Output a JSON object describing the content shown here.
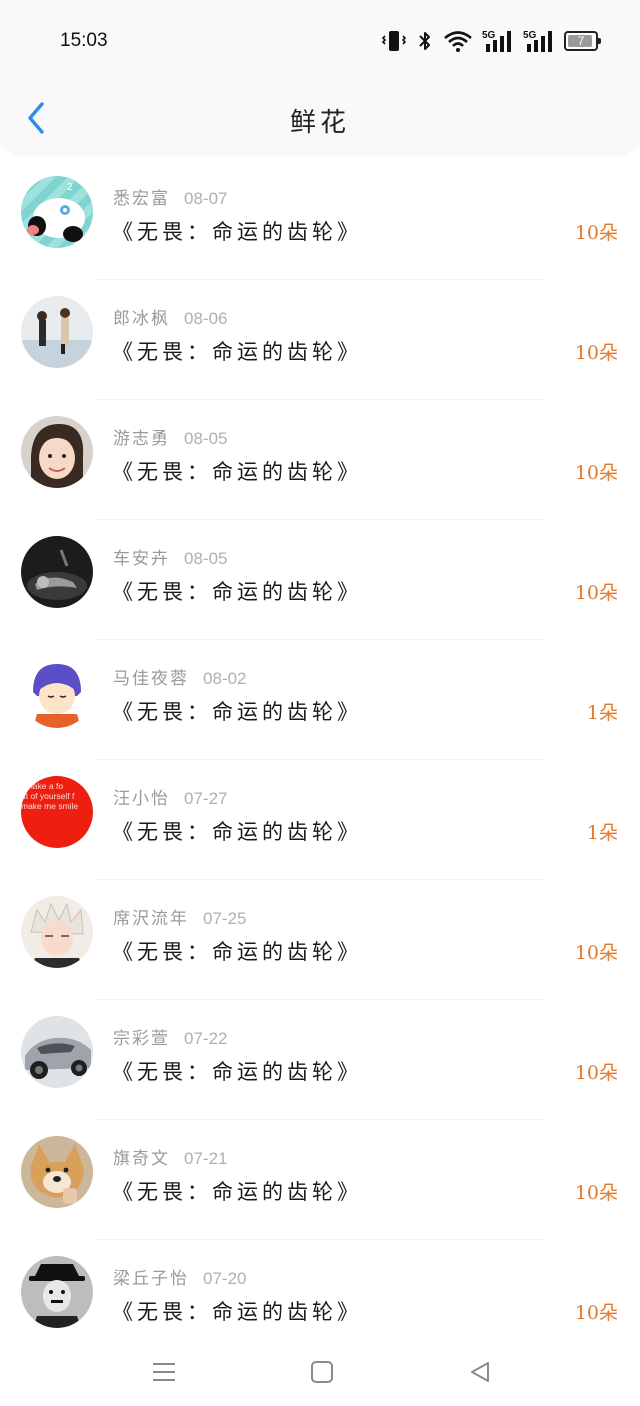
{
  "status": {
    "time": "15:03",
    "battery": "7",
    "icons": [
      "vibrate-icon",
      "bluetooth-icon",
      "wifi-icon",
      "signal-5g-icon",
      "signal-5g-icon"
    ]
  },
  "header": {
    "title": "鲜花",
    "back_icon": "chevron-left-icon",
    "accent": "#2a8ee8"
  },
  "colors": {
    "count": "#e07b2f",
    "meta": "#9a9a9a"
  },
  "rows": [
    {
      "name": "悉宏富",
      "date": "08-07",
      "book": "《无畏：命运的齿轮》",
      "count": "10朵",
      "avatar": "panda-cartoon"
    },
    {
      "name": "郎冰枫",
      "date": "08-06",
      "book": "《无畏：命运的齿轮》",
      "count": "10朵",
      "avatar": "couple-photo"
    },
    {
      "name": "游志勇",
      "date": "08-05",
      "book": "《无畏：命运的齿轮》",
      "count": "10朵",
      "avatar": "girl-photo"
    },
    {
      "name": "车安卉",
      "date": "08-05",
      "book": "《无畏：命运的齿轮》",
      "count": "10朵",
      "avatar": "dark-photo"
    },
    {
      "name": "马佳夜蓉",
      "date": "08-02",
      "book": "《无畏：命运的齿轮》",
      "count": "1朵",
      "avatar": "cartoon-boy"
    },
    {
      "name": "汪小怡",
      "date": "07-27",
      "book": "《无畏：命运的齿轮》",
      "count": "1朵",
      "avatar": "red-text",
      "avatar_text": [
        "t make a fo",
        "ut of yourself f",
        "make me smile"
      ]
    },
    {
      "name": "席沢流年",
      "date": "07-25",
      "book": "《无畏：命运的齿轮》",
      "count": "10朵",
      "avatar": "anime-boy"
    },
    {
      "name": "宗彩萱",
      "date": "07-22",
      "book": "《无畏：命运的齿轮》",
      "count": "10朵",
      "avatar": "car-photo"
    },
    {
      "name": "旗奇文",
      "date": "07-21",
      "book": "《无畏：命运的齿轮》",
      "count": "10朵",
      "avatar": "dog-photo"
    },
    {
      "name": "梁丘子怡",
      "date": "07-20",
      "book": "《无畏：命运的齿轮》",
      "count": "10朵",
      "avatar": "bw-portrait"
    }
  ],
  "bottom_nav": {
    "icons": [
      "menu-icon",
      "home-square-icon",
      "back-triangle-icon"
    ]
  }
}
